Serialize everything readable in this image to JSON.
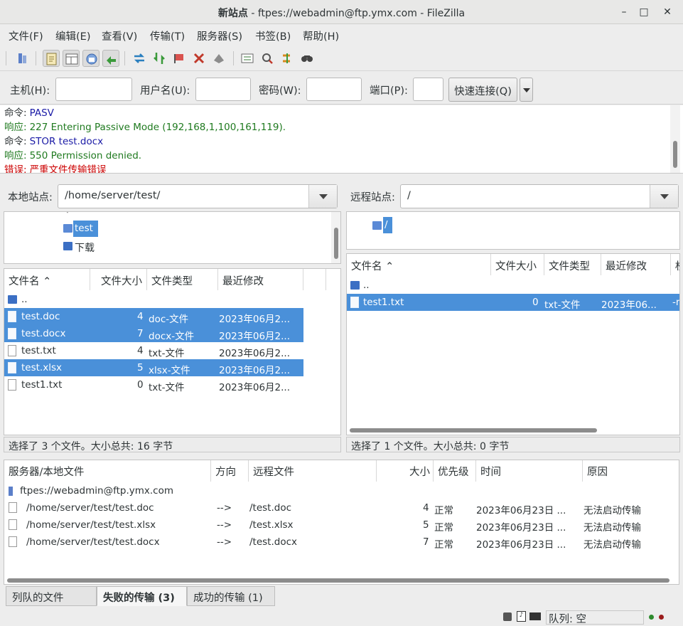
{
  "window": {
    "title_bold": "新站点",
    "title_rest": " - ftpes://webadmin@ftp.ymx.com - FileZilla",
    "minimize": "–",
    "maximize": "□",
    "close": "✕"
  },
  "menu": [
    "文件(F)",
    "编辑(E)",
    "查看(V)",
    "传输(T)",
    "服务器(S)",
    "书签(B)",
    "帮助(H)"
  ],
  "quickconnect": {
    "host_label": "主机(H):",
    "host_value": "",
    "user_label": "用户名(U):",
    "user_value": "",
    "password_label": "密码(W):",
    "password_value": "",
    "port_label": "端口(P):",
    "port_value": "",
    "connect_button": "快速连接(Q)"
  },
  "log": [
    {
      "prefix": "命令:",
      "text": "PASV",
      "color": "#1a1aa6"
    },
    {
      "prefix": "响应:",
      "text": "227 Entering Passive Mode (192,168,1,100,161,119).",
      "color": "#1f7a1f"
    },
    {
      "prefix": "命令:",
      "text": "STOR test.docx",
      "color": "#1a1aa6"
    },
    {
      "prefix": "响应:",
      "text": "550 Permission denied.",
      "color": "#1f7a1f"
    },
    {
      "prefix": "错误:",
      "text": "严重文件传输错误",
      "color": "#cc0000"
    }
  ],
  "local": {
    "label": "本地站点:",
    "path": "/home/server/test/",
    "tree": [
      {
        "name": "test",
        "selected": true
      },
      {
        "name": "下载",
        "selected": false
      }
    ],
    "columns": [
      "文件名",
      "文件大小",
      "文件类型",
      "最近修改"
    ],
    "files": [
      {
        "name": "..",
        "size": "",
        "type": "",
        "modified": "",
        "dir": true,
        "selected": false
      },
      {
        "name": "test.doc",
        "size": "4",
        "type": "doc-文件",
        "modified": "2023年06月2...",
        "dir": false,
        "selected": true
      },
      {
        "name": "test.docx",
        "size": "7",
        "type": "docx-文件",
        "modified": "2023年06月2...",
        "dir": false,
        "selected": true
      },
      {
        "name": "test.txt",
        "size": "4",
        "type": "txt-文件",
        "modified": "2023年06月2...",
        "dir": false,
        "selected": false
      },
      {
        "name": "test.xlsx",
        "size": "5",
        "type": "xlsx-文件",
        "modified": "2023年06月2...",
        "dir": false,
        "selected": true
      },
      {
        "name": "test1.txt",
        "size": "0",
        "type": "txt-文件",
        "modified": "2023年06月2...",
        "dir": false,
        "selected": false
      }
    ],
    "status": "选择了 3 个文件。大小总共: 16 字节"
  },
  "remote": {
    "label": "远程站点:",
    "path": "/",
    "tree_root": "/",
    "columns": [
      "文件名",
      "文件大小",
      "文件类型",
      "最近修改",
      "权"
    ],
    "files": [
      {
        "name": "..",
        "size": "",
        "type": "",
        "modified": "",
        "perm": "",
        "dir": true,
        "selected": false
      },
      {
        "name": "test1.txt",
        "size": "0",
        "type": "txt-文件",
        "modified": "2023年06...",
        "perm": "-r",
        "dir": false,
        "selected": true
      }
    ],
    "status": "选择了 1 个文件。大小总共: 0 字节"
  },
  "queue": {
    "columns": [
      "服务器/本地文件",
      "方向",
      "远程文件",
      "大小",
      "优先级",
      "时间",
      "原因"
    ],
    "server": "ftpes://webadmin@ftp.ymx.com",
    "items": [
      {
        "local": "/home/server/test/test.doc",
        "dir": "-->",
        "remote": "/test.doc",
        "size": "4",
        "priority": "正常",
        "time": "2023年06月23日 ...",
        "reason": "无法启动传输"
      },
      {
        "local": "/home/server/test/test.xlsx",
        "dir": "-->",
        "remote": "/test.xlsx",
        "size": "5",
        "priority": "正常",
        "time": "2023年06月23日 ...",
        "reason": "无法启动传输"
      },
      {
        "local": "/home/server/test/test.docx",
        "dir": "-->",
        "remote": "/test.docx",
        "size": "7",
        "priority": "正常",
        "time": "2023年06月23日 ...",
        "reason": "无法启动传输"
      }
    ],
    "tabs": [
      "列队的文件",
      "失败的传输 (3)",
      "成功的传输 (1)"
    ],
    "active_tab": 1
  },
  "statusbar": {
    "queue_label": "队列: 空"
  },
  "colors": {
    "selection": "#4a90d9",
    "log_command": "#1a1aa6",
    "log_response": "#1f7a1f",
    "log_error": "#cc0000"
  }
}
